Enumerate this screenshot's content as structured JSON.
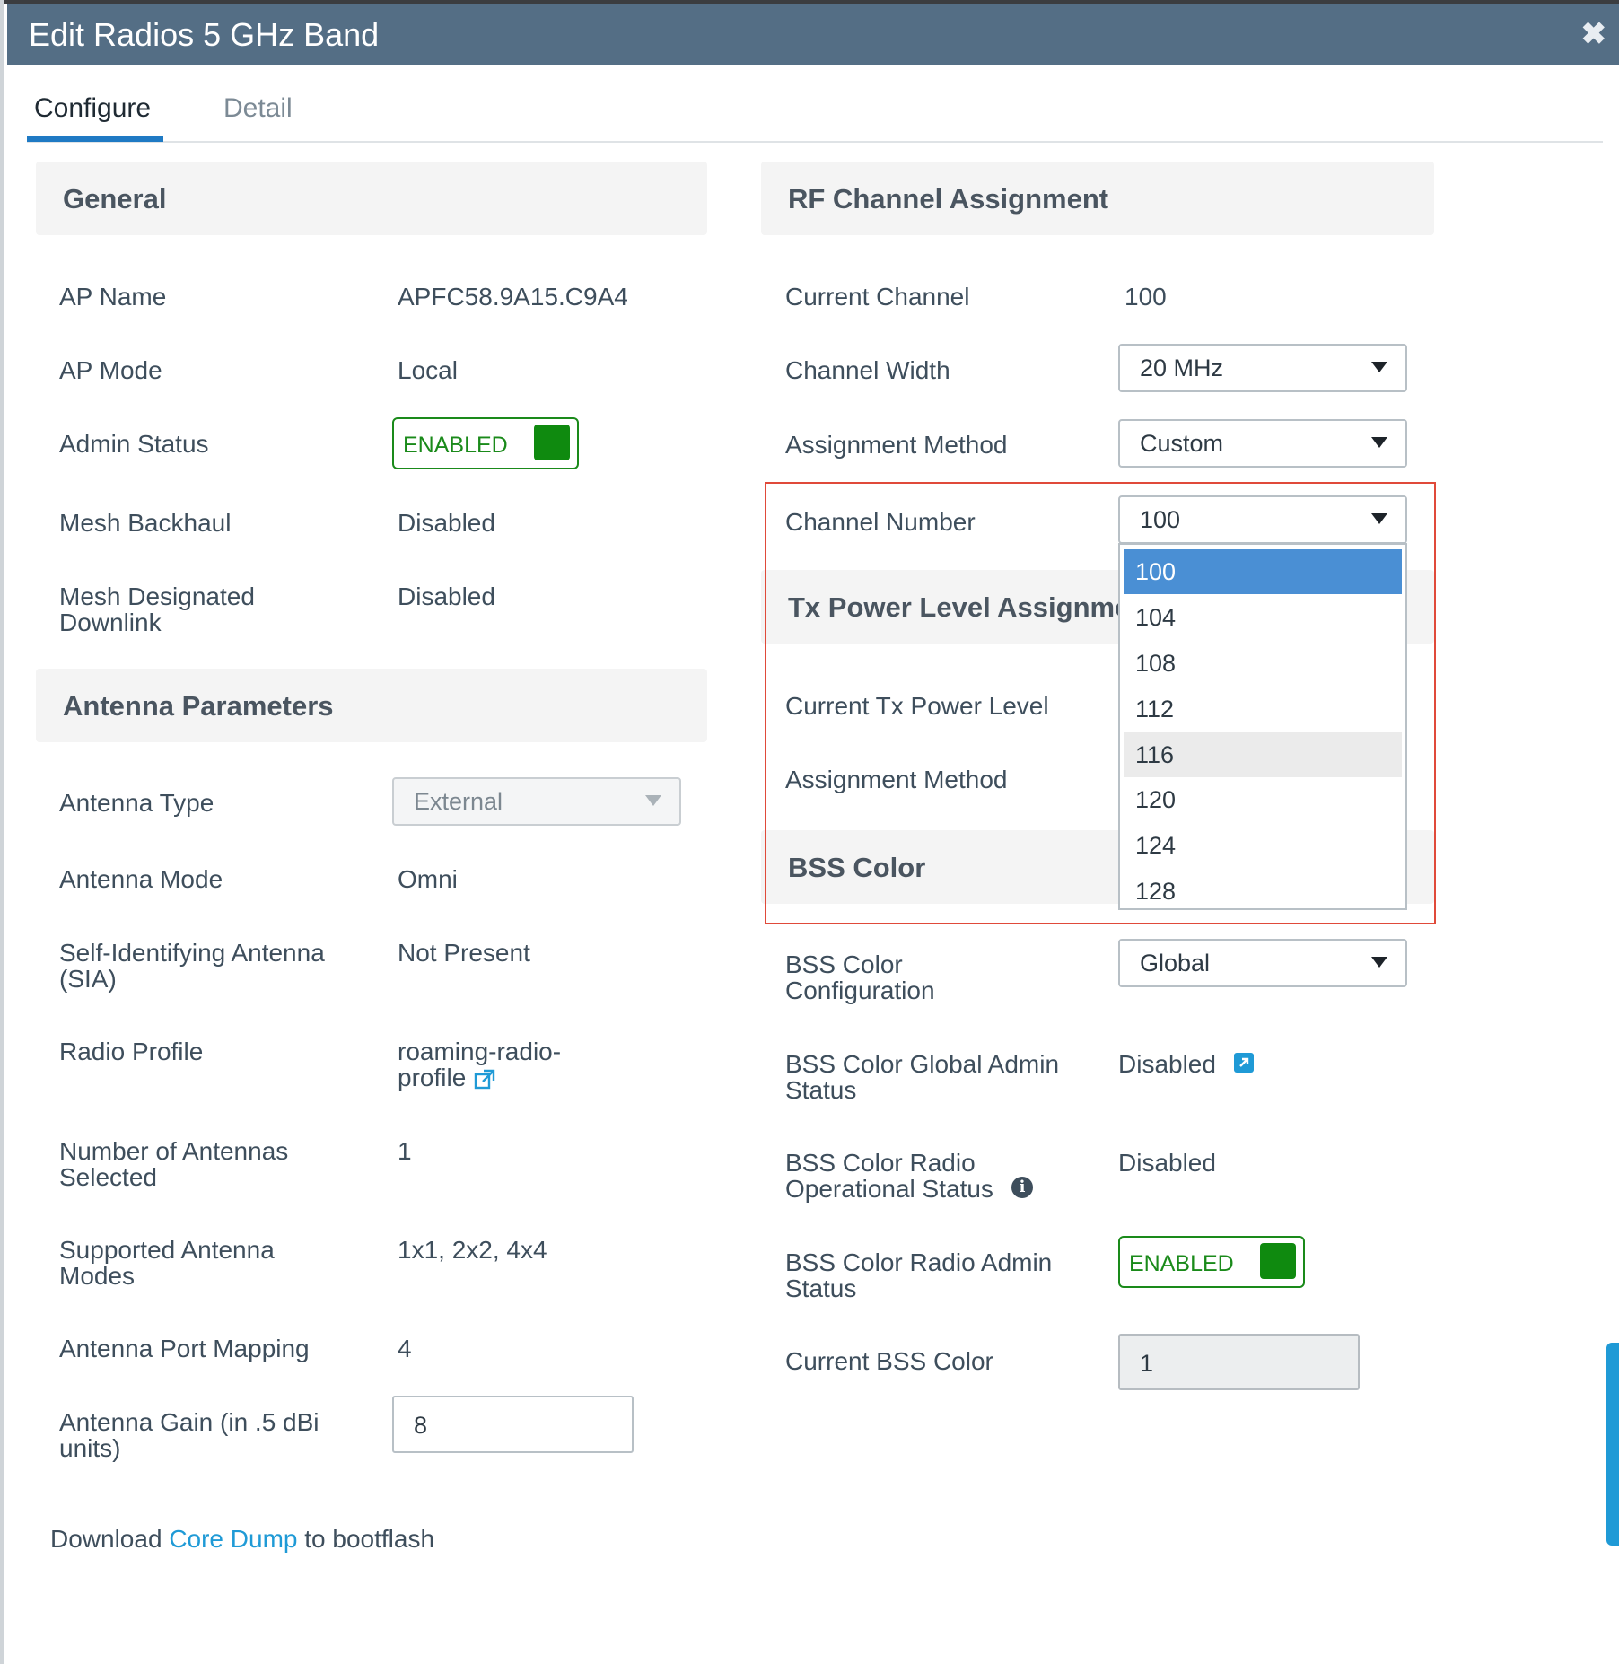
{
  "window": {
    "title": "Edit Radios 5 GHz Band",
    "close_icon": "close-icon"
  },
  "tabs": [
    {
      "label": "Configure",
      "active": true
    },
    {
      "label": "Detail",
      "active": false
    }
  ],
  "general": {
    "title": "General",
    "rows": [
      {
        "label": "AP Name",
        "value": "APFC58.9A15.C9A4"
      },
      {
        "label": "AP Mode",
        "value": "Local"
      },
      {
        "label": "Admin Status",
        "value": "ENABLED"
      },
      {
        "label": "Mesh Backhaul",
        "value": "Disabled"
      },
      {
        "label": "Mesh Designated Downlink",
        "value": "Disabled"
      }
    ]
  },
  "antenna": {
    "title": "Antenna Parameters",
    "antenna_type_label": "Antenna Type",
    "antenna_type_value": "External",
    "antenna_mode_label": "Antenna Mode",
    "antenna_mode_value": "Omni",
    "sia_label": "Self-Identifying Antenna (SIA)",
    "sia_value": "Not Present",
    "radio_profile_label": "Radio Profile",
    "radio_profile_value": "roaming-radio-profile",
    "num_antennas_label": "Number of Antennas Selected",
    "num_antennas_value": "1",
    "supported_modes_label": "Supported Antenna Modes",
    "supported_modes_value": "1x1, 2x2, 4x4",
    "port_mapping_label": "Antenna Port Mapping",
    "port_mapping_value": "4",
    "gain_label": "Antenna Gain (in .5 dBi units)",
    "gain_value": "8"
  },
  "footer": {
    "prefix": "Download ",
    "link": "Core Dump",
    "suffix": " to bootflash"
  },
  "rf": {
    "title": "RF Channel Assignment",
    "current_channel_label": "Current Channel",
    "current_channel_value": "100",
    "channel_width_label": "Channel Width",
    "channel_width_value": "20 MHz",
    "assignment_method_label": "Assignment Method",
    "assignment_method_value": "Custom",
    "channel_number_label": "Channel Number",
    "channel_number_value": "100",
    "channel_options": [
      "100",
      "104",
      "108",
      "112",
      "116",
      "120",
      "124",
      "128"
    ],
    "selected_option": "100",
    "hover_option": "116"
  },
  "tx": {
    "title": "Tx Power Level Assignmer",
    "current_level_label": "Current Tx Power Level",
    "assignment_method_label": "Assignment Method"
  },
  "bss": {
    "title": "BSS Color",
    "config_label": "BSS Color Configuration",
    "config_value": "Global",
    "global_admin_label": "BSS Color Global Admin Status",
    "global_admin_value": "Disabled",
    "radio_oper_label": "BSS Color Radio Operational Status",
    "radio_oper_value": "Disabled",
    "radio_admin_label": "BSS Color Radio Admin Status",
    "radio_admin_value": "ENABLED",
    "current_color_label": "Current BSS Color",
    "current_color_value": "1"
  },
  "colors": {
    "header": "#546e85",
    "accent": "#1f7ac4",
    "link": "#1f9ad6",
    "enabled": "#1a8a1a",
    "highlight_box": "#e04a3a",
    "selected_option": "#4a8fd4"
  }
}
